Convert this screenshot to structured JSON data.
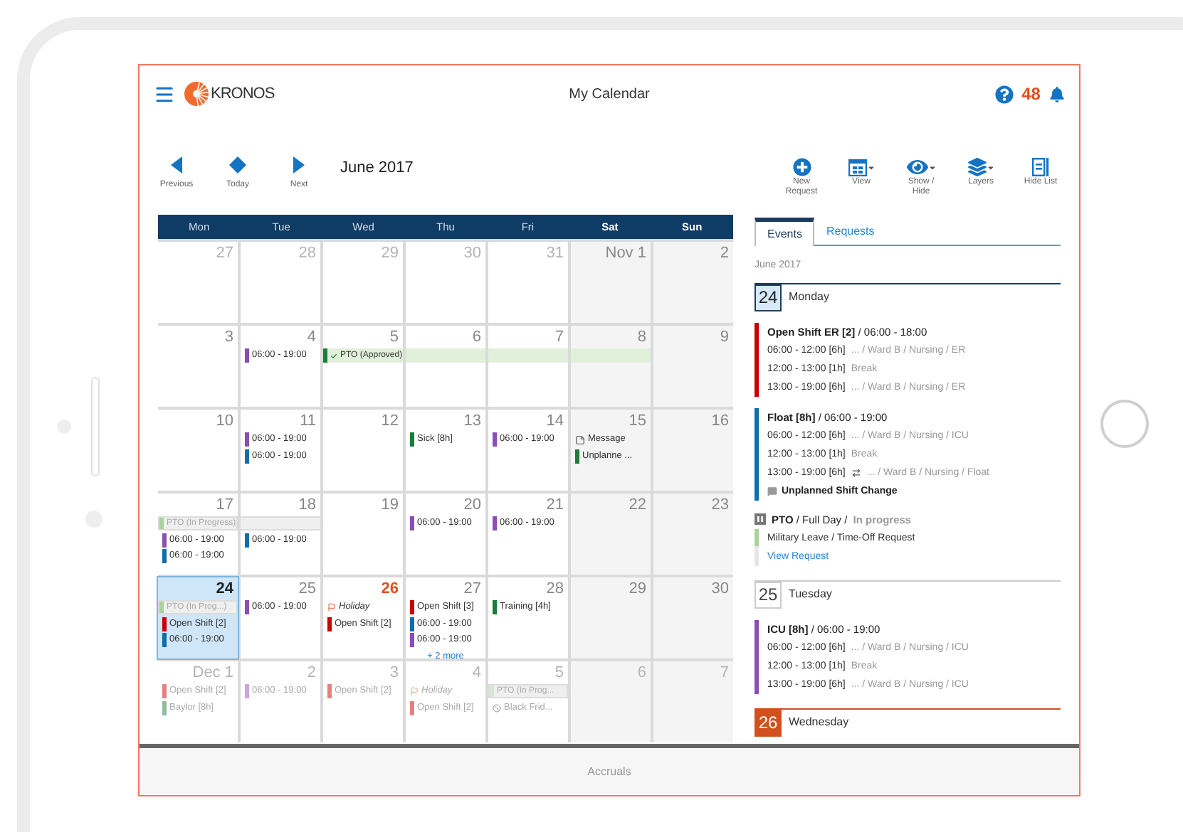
{
  "header": {
    "logo_text": "KRONOS",
    "title": "My Calendar",
    "notification_count": "48"
  },
  "nav": {
    "buttons": [
      {
        "kind": "previous",
        "label": "Previous"
      },
      {
        "kind": "today",
        "label": "Today"
      },
      {
        "kind": "next",
        "label": "Next"
      }
    ],
    "month": "June 2017"
  },
  "toolbar": [
    {
      "kind": "new",
      "label": "New Request",
      "dropdown": false
    },
    {
      "kind": "view",
      "label": "View",
      "dropdown": true
    },
    {
      "kind": "eye",
      "label": "Show / Hide",
      "dropdown": true
    },
    {
      "kind": "layers",
      "label": "Layers",
      "dropdown": true
    },
    {
      "kind": "list",
      "label": "Hide List",
      "dropdown": false
    }
  ],
  "calendar": {
    "weekdays": [
      {
        "label": "Mon",
        "weekend": false
      },
      {
        "label": "Tue",
        "weekend": false
      },
      {
        "label": "Wed",
        "weekend": false
      },
      {
        "label": "Thu",
        "weekend": false
      },
      {
        "label": "Fri",
        "weekend": false
      },
      {
        "label": "Sat",
        "weekend": true
      },
      {
        "label": "Sun",
        "weekend": true
      }
    ],
    "weeks": [
      {
        "cells": [
          {
            "day": "27",
            "muted": true,
            "selected": false,
            "today": false
          },
          {
            "day": "28",
            "muted": true,
            "selected": false,
            "today": false
          },
          {
            "day": "29",
            "muted": true,
            "selected": false,
            "today": false
          },
          {
            "day": "30",
            "muted": true,
            "selected": false,
            "today": false
          },
          {
            "day": "31",
            "muted": true,
            "selected": false,
            "today": false
          },
          {
            "day": "Nov 1",
            "muted": false,
            "selected": false,
            "today": false
          },
          {
            "day": "2",
            "muted": false,
            "selected": false,
            "today": false
          }
        ]
      },
      {
        "cells": [
          {
            "day": "3",
            "muted": false,
            "selected": false,
            "today": false
          },
          {
            "day": "4",
            "muted": false,
            "selected": false,
            "today": false,
            "events": [
              {
                "kind": "bar",
                "color": "#8b4db8",
                "text": "06:00 - 19:00"
              }
            ]
          },
          {
            "day": "5",
            "muted": false,
            "selected": false,
            "today": false,
            "events": [
              {
                "kind": "approved_span",
                "color": "#1a7d3a",
                "text": "PTO (Approved)"
              }
            ]
          },
          {
            "day": "6",
            "muted": false,
            "selected": false,
            "today": false,
            "events": [
              {
                "kind": "span_cont"
              }
            ]
          },
          {
            "day": "7",
            "muted": false,
            "selected": false,
            "today": false,
            "events": [
              {
                "kind": "span_cont"
              }
            ]
          },
          {
            "day": "8",
            "muted": false,
            "selected": false,
            "today": false,
            "events": [
              {
                "kind": "span_cont"
              }
            ]
          },
          {
            "day": "9",
            "muted": false,
            "selected": false,
            "today": false
          }
        ]
      },
      {
        "cells": [
          {
            "day": "10",
            "muted": false,
            "selected": false,
            "today": false
          },
          {
            "day": "11",
            "muted": false,
            "selected": false,
            "today": false,
            "events": [
              {
                "kind": "bar",
                "color": "#8b4db8",
                "text": "06:00 - 19:00"
              },
              {
                "kind": "bar",
                "color": "#0b6fae",
                "text": "06:00 - 19:00"
              }
            ]
          },
          {
            "day": "12",
            "muted": false,
            "selected": false,
            "today": false
          },
          {
            "day": "13",
            "muted": false,
            "selected": false,
            "today": false,
            "events": [
              {
                "kind": "bar",
                "color": "#1a7d3a",
                "text": "Sick [8h]"
              }
            ]
          },
          {
            "day": "14",
            "muted": false,
            "selected": false,
            "today": false,
            "events": [
              {
                "kind": "bar",
                "color": "#8b4db8",
                "text": "06:00 - 19:00"
              }
            ]
          },
          {
            "day": "15",
            "muted": false,
            "selected": false,
            "today": false,
            "events": [
              {
                "kind": "message",
                "text": "Message"
              },
              {
                "kind": "bar",
                "color": "#1a7d3a",
                "text": "Unplanne ..."
              }
            ]
          },
          {
            "day": "16",
            "muted": false,
            "selected": false,
            "today": false
          }
        ]
      },
      {
        "cells": [
          {
            "day": "17",
            "muted": false,
            "selected": false,
            "today": false,
            "events": [
              {
                "kind": "pending_span",
                "color": "#a6d49a",
                "text": "PTO (In Progress)"
              },
              {
                "kind": "bar",
                "color": "#8b4db8",
                "text": "06:00 - 19:00"
              },
              {
                "kind": "bar",
                "color": "#0b6fae",
                "text": "06:00 - 19:00"
              }
            ]
          },
          {
            "day": "18",
            "muted": false,
            "selected": false,
            "today": false,
            "events": [
              {
                "kind": "span_cont"
              },
              {
                "kind": "bar",
                "color": "#0b6fae",
                "text": "06:00 - 19:00"
              }
            ]
          },
          {
            "day": "19",
            "muted": false,
            "selected": false,
            "today": false
          },
          {
            "day": "20",
            "muted": false,
            "selected": false,
            "today": false,
            "events": [
              {
                "kind": "bar",
                "color": "#8b4db8",
                "text": "06:00 - 19:00"
              }
            ]
          },
          {
            "day": "21",
            "muted": false,
            "selected": false,
            "today": false,
            "events": [
              {
                "kind": "bar",
                "color": "#8b4db8",
                "text": "06:00 - 19:00"
              }
            ]
          },
          {
            "day": "22",
            "muted": false,
            "selected": false,
            "today": false
          },
          {
            "day": "23",
            "muted": false,
            "selected": false,
            "today": false
          }
        ]
      },
      {
        "cells": [
          {
            "day": "24",
            "muted": false,
            "selected": true,
            "today": false,
            "events": [
              {
                "kind": "pending_span",
                "color": "#a6d49a",
                "text": "PTO (In Prog...)"
              },
              {
                "kind": "bar",
                "color": "#cc0000",
                "text": "Open Shift [2]"
              },
              {
                "kind": "bar",
                "color": "#0b6fae",
                "text": "06:00 - 19:00"
              }
            ]
          },
          {
            "day": "25",
            "muted": false,
            "selected": false,
            "today": false,
            "events": [
              {
                "kind": "bar",
                "color": "#8b4db8",
                "text": "06:00 - 19:00"
              }
            ]
          },
          {
            "day": "26",
            "muted": false,
            "selected": false,
            "today": true,
            "events": [
              {
                "kind": "holiday",
                "text": "Holiday"
              },
              {
                "kind": "bar",
                "color": "#cc0000",
                "text": "Open Shift [2]"
              }
            ]
          },
          {
            "day": "27",
            "muted": false,
            "selected": false,
            "today": false,
            "events": [
              {
                "kind": "bar",
                "color": "#cc0000",
                "text": "Open Shift [3]"
              },
              {
                "kind": "bar",
                "color": "#0b6fae",
                "text": "06:00 - 19:00"
              },
              {
                "kind": "bar",
                "color": "#8b4db8",
                "text": "06:00 - 19:00"
              },
              {
                "kind": "more",
                "text": "+ 2 more"
              }
            ]
          },
          {
            "day": "28",
            "muted": false,
            "selected": false,
            "today": false,
            "events": [
              {
                "kind": "bar",
                "color": "#1a7d3a",
                "text": "Training [4h]"
              }
            ]
          },
          {
            "day": "29",
            "muted": false,
            "selected": false,
            "today": false
          },
          {
            "day": "30",
            "muted": false,
            "selected": false,
            "today": false
          }
        ]
      },
      {
        "cells": [
          {
            "day": "Dec 1",
            "muted": true,
            "selected": false,
            "today": false,
            "events": [
              {
                "kind": "bar",
                "color": "#e58080",
                "text": "Open Shift [2]"
              },
              {
                "kind": "bar",
                "color": "#8cbf9c",
                "text": "Baylor [8h]"
              }
            ]
          },
          {
            "day": "2",
            "muted": true,
            "selected": false,
            "today": false,
            "events": [
              {
                "kind": "bar",
                "color": "#c9a6dc",
                "text": "06:00 - 19:00"
              }
            ]
          },
          {
            "day": "3",
            "muted": true,
            "selected": false,
            "today": false,
            "events": [
              {
                "kind": "bar",
                "color": "#e58080",
                "text": "Open Shift [2]"
              }
            ]
          },
          {
            "day": "4",
            "muted": true,
            "selected": false,
            "today": false,
            "events": [
              {
                "kind": "holiday",
                "text": "Holiday"
              },
              {
                "kind": "bar",
                "color": "#e58080",
                "text": "Open Shift [2]"
              }
            ]
          },
          {
            "day": "5",
            "muted": true,
            "selected": false,
            "today": false,
            "events": [
              {
                "kind": "pending_span",
                "color": "#d3ead0",
                "text": "PTO (In Prog..."
              },
              {
                "kind": "closed",
                "text": "Black Frid..."
              }
            ]
          },
          {
            "day": "6",
            "muted": true,
            "selected": false,
            "today": false
          },
          {
            "day": "7",
            "muted": true,
            "selected": false,
            "today": false
          }
        ]
      }
    ]
  },
  "panel": {
    "tabs": [
      {
        "label": "Events",
        "selected": true
      },
      {
        "label": "Requests",
        "selected": false
      }
    ],
    "month": "June 2017",
    "days": [
      {
        "date": "24",
        "weekday": "Monday",
        "selected": true,
        "today": false,
        "events": [
          {
            "kind": "shift",
            "color": "#cc0000",
            "title": "**Open Shift ER [2]** / 06:00 - 18:00",
            "lines": [
              {
                "time": "06:00 - 12:00 [6h]",
                "detail": "... / Ward B / Nursing / ER"
              },
              {
                "time": "12:00 - 13:00 [1h]",
                "detail": "Break"
              },
              {
                "time": "13:00 - 19:00 [6h]",
                "detail": "... / Ward B / Nursing / ER"
              }
            ]
          },
          {
            "kind": "shift",
            "color": "#0b6fae",
            "title": "**Float [8h]** / 06:00 - 19:00",
            "lines": [
              {
                "time": "06:00 - 12:00 [6h]",
                "detail": "... / Ward B / Nursing / ICU"
              },
              {
                "time": "12:00 - 13:00 [1h]",
                "detail": "Break"
              },
              {
                "time": "13:00 - 19:00 [6h]",
                "detail": "... / Ward B / Nursing / Float",
                "transfer": true
              }
            ],
            "note": "Unplanned Shift Change"
          },
          {
            "kind": "pto",
            "title": "**PTO** / Full Day /",
            "status": "In progress",
            "detail": "Military Leave / Time-Off Request",
            "link": "View Request"
          }
        ]
      },
      {
        "date": "25",
        "weekday": "Tuesday",
        "selected": false,
        "today": false,
        "events": [
          {
            "kind": "shift",
            "color": "#8b4db8",
            "title": "**ICU [8h]** / 06:00 - 19:00",
            "lines": [
              {
                "time": "06:00 - 12:00 [6h]",
                "detail": "... / Ward B / Nursing / ICU"
              },
              {
                "time": "12:00 - 13:00 [1h]",
                "detail": "Break"
              },
              {
                "time": "13:00 - 19:00 [6h]",
                "detail": "... / Ward B / Nursing / ICU"
              }
            ]
          }
        ]
      },
      {
        "date": "26",
        "weekday": "Wednesday",
        "selected": false,
        "today": true
      }
    ]
  },
  "footer": {
    "label": "Accruals"
  }
}
